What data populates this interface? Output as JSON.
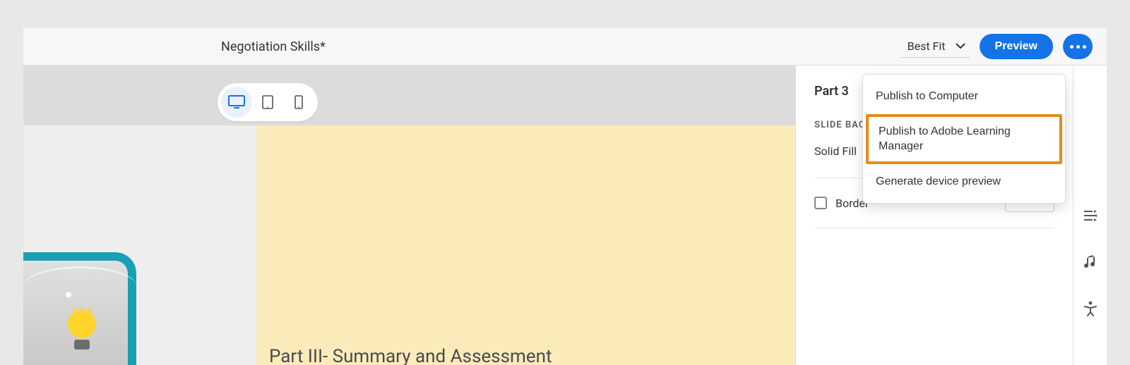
{
  "header": {
    "title": "Negotiation Skills*",
    "zoom_label": "Best Fit",
    "preview_label": "Preview"
  },
  "device_switcher": {
    "active": "desktop"
  },
  "slide": {
    "title": "Part III- Summary and Assessment"
  },
  "panel": {
    "title": "Part 3",
    "section_label": "SLIDE BACKGROUND",
    "fill_type": "Solid Fill",
    "border_label": "Border"
  },
  "popup": {
    "items": [
      {
        "label": "Publish to Computer"
      },
      {
        "label": "Publish to Adobe Learning Manager",
        "highlighted": true
      },
      {
        "label": "Generate device preview"
      }
    ]
  }
}
